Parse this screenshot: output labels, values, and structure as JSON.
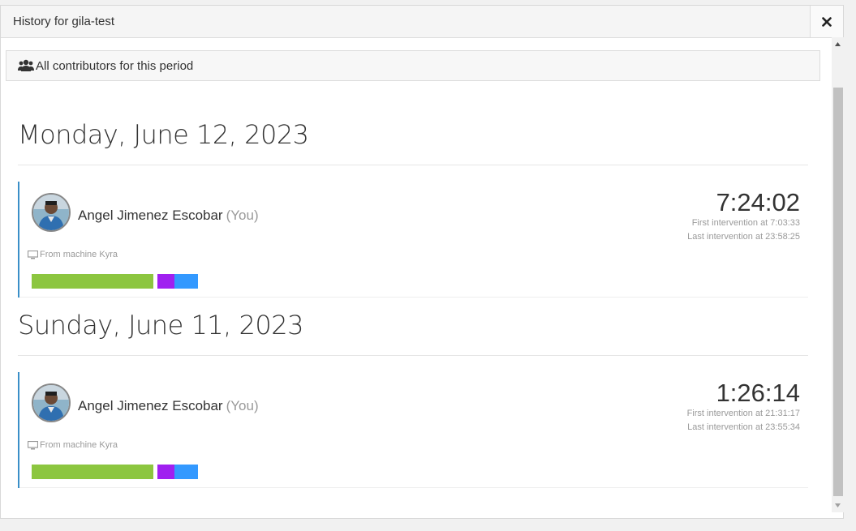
{
  "header": {
    "title": "History for gila-test",
    "close_icon": "close-icon"
  },
  "contributors": {
    "label": "All contributors for this period",
    "icon": "users-icon"
  },
  "days": [
    {
      "date": "Monday, June 12, 2023",
      "entry": {
        "name": "Angel Jimenez Escobar",
        "you": "(You)",
        "duration": "7:24:02",
        "first_intervention": "First intervention at 7:03:33",
        "last_intervention": "Last intervention at 23:58:25",
        "machine": "From machine Kyra"
      }
    },
    {
      "date": "Sunday, June 11, 2023",
      "entry": {
        "name": "Angel Jimenez Escobar",
        "you": "(You)",
        "duration": "1:26:14",
        "first_intervention": "First intervention at 21:31:17",
        "last_intervention": "Last intervention at 23:55:34",
        "machine": "From machine Kyra"
      }
    }
  ],
  "colors": {
    "accent_border": "#3a8fc8",
    "bar_green": "#8cc63f",
    "bar_purple": "#a020f0",
    "bar_blue": "#3399ff"
  }
}
